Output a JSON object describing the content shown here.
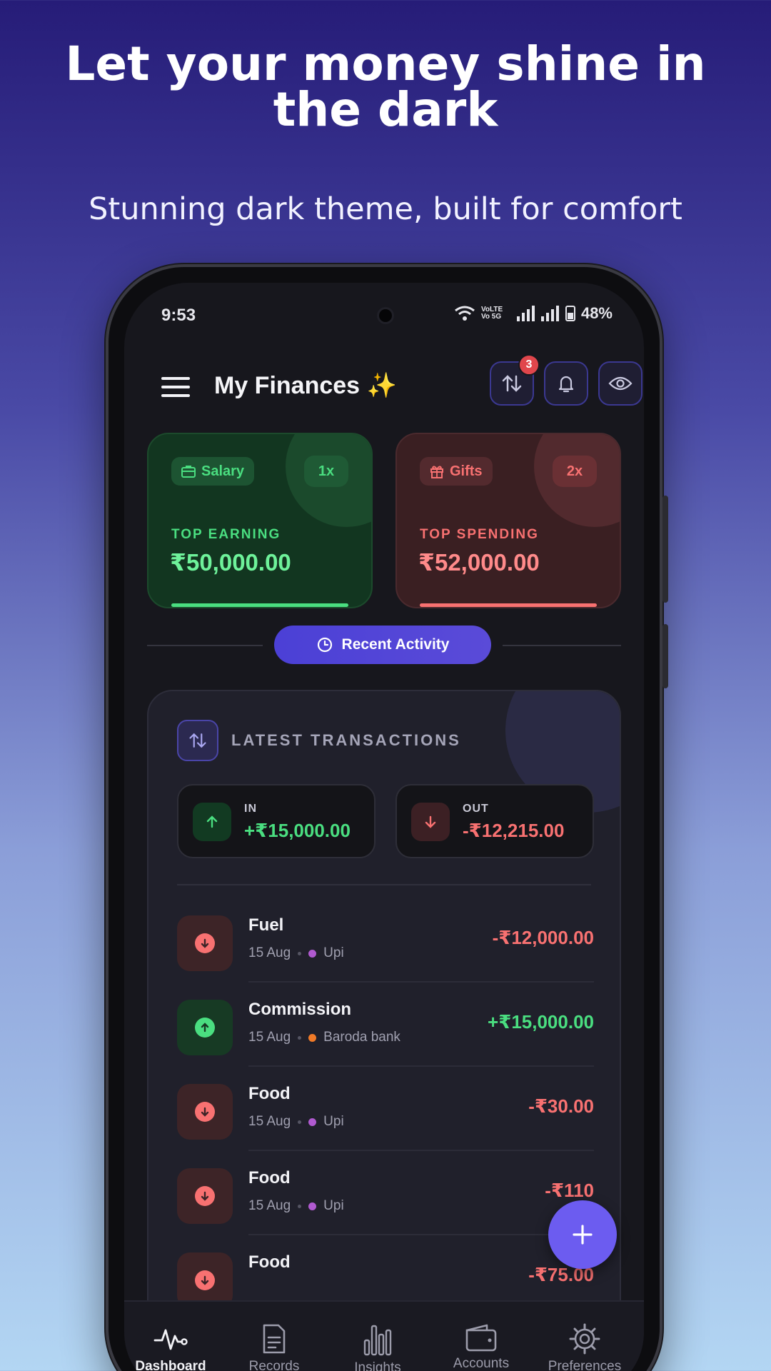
{
  "promo": {
    "headline": "Let your money shine in the dark",
    "subline": "Stunning dark theme, built for comfort"
  },
  "status_bar": {
    "time": "9:53",
    "network": "VoLTE Vo 5G",
    "battery": "48%"
  },
  "app_bar": {
    "title": "My Finances ✨",
    "transfer_badge": "3",
    "icons": [
      "menu-icon",
      "transfer-icon",
      "bell-icon",
      "eye-icon"
    ]
  },
  "top_cards": {
    "earning": {
      "chip": "Salary",
      "multiplier": "1x",
      "caption": "TOP EARNING",
      "amount": "₹50,000.00",
      "color": "#4ade80"
    },
    "spending": {
      "chip": "Gifts",
      "multiplier": "2x",
      "caption": "TOP SPENDING",
      "amount": "₹52,000.00",
      "color": "#f87171"
    }
  },
  "recent_activity": {
    "label": "Recent Activity"
  },
  "transactions": {
    "title": "LATEST TRANSACTIONS",
    "in_label": "IN",
    "in_amount": "+₹15,000.00",
    "out_label": "OUT",
    "out_amount": "-₹12,215.00",
    "items": [
      {
        "title": "Fuel",
        "date": "15 Aug",
        "account": "Upi",
        "amount": "-₹12,000.00",
        "type": "out"
      },
      {
        "title": "Commission",
        "date": "15 Aug",
        "account": "Baroda bank",
        "amount": "+₹15,000.00",
        "type": "in"
      },
      {
        "title": "Food",
        "date": "15 Aug",
        "account": "Upi",
        "amount": "-₹30.00",
        "type": "out"
      },
      {
        "title": "Food",
        "date": "15 Aug",
        "account": "Upi",
        "amount": "-₹110",
        "type": "out"
      },
      {
        "title": "Food",
        "date": "",
        "account": "",
        "amount": "-₹75.00",
        "type": "out"
      }
    ]
  },
  "bottom_nav": {
    "items": [
      {
        "label": "Dashboard",
        "icon": "pulse-icon"
      },
      {
        "label": "Records",
        "icon": "document-icon"
      },
      {
        "label": "Insights",
        "icon": "bar-chart-icon"
      },
      {
        "label": "Accounts",
        "icon": "wallet-icon"
      },
      {
        "label": "Preferences",
        "icon": "gear-icon"
      }
    ]
  },
  "colors": {
    "accent": "#5a4bd8",
    "income": "#4ade80",
    "expense": "#f87171",
    "upi_dot": "#b05ad0",
    "bank_dot": "#f07a28"
  }
}
